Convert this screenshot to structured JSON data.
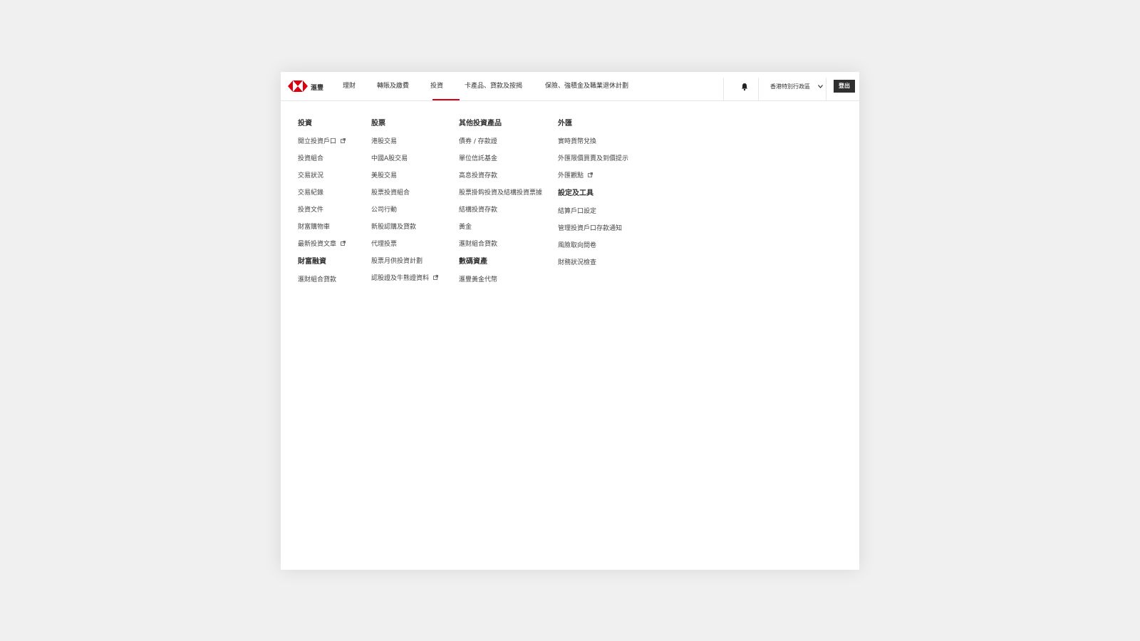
{
  "brand": {
    "name": "滙豐",
    "logo_icon": "hsbc-hexagon-logo-icon",
    "accent_color": "#db0011"
  },
  "nav": {
    "items": [
      {
        "label": "理財"
      },
      {
        "label": "轉賬及繳費"
      },
      {
        "label": "投資",
        "active": true
      },
      {
        "label": "卡產品、貸款及按揭"
      },
      {
        "label": "保險、強積金及職業退休計劃"
      }
    ],
    "notification_icon": "bell-icon",
    "region": "香港特別行政區",
    "logout_label": "登出"
  },
  "menu": {
    "columns": [
      {
        "groups": [
          {
            "title": "投資",
            "links": [
              {
                "label": "開立投資戶口",
                "external": true
              },
              {
                "label": "投資組合"
              },
              {
                "label": "交易狀況"
              },
              {
                "label": "交易紀錄"
              },
              {
                "label": "投資文件"
              },
              {
                "label": "財富購物車"
              },
              {
                "label": "最新投資文章",
                "external": true
              }
            ]
          },
          {
            "title": "財富融資",
            "links": [
              {
                "label": "滙財組合貸款"
              }
            ]
          }
        ]
      },
      {
        "groups": [
          {
            "title": "股票",
            "links": [
              {
                "label": "港股交易"
              },
              {
                "label": "中國A股交易"
              },
              {
                "label": "美股交易"
              },
              {
                "label": "股票投資組合"
              },
              {
                "label": "公司行動"
              },
              {
                "label": "新股認購及貸款"
              },
              {
                "label": "代理投票"
              },
              {
                "label": "股票月供投資計劃"
              },
              {
                "label": "認股證及牛熊證資料",
                "external": true
              }
            ]
          }
        ]
      },
      {
        "groups": [
          {
            "title": "其他投資產品",
            "links": [
              {
                "label": "債券 / 存款證"
              },
              {
                "label": "單位信託基金"
              },
              {
                "label": "高息投資存款"
              },
              {
                "label": "股票掛鈎投資及結構投資票據"
              },
              {
                "label": "結構投資存款"
              },
              {
                "label": "黃金"
              },
              {
                "label": "滙財組合貸款"
              }
            ]
          },
          {
            "title": "數碼資產",
            "links": [
              {
                "label": "滙豐黃金代幣"
              }
            ]
          }
        ]
      },
      {
        "groups": [
          {
            "title": "外匯",
            "links": [
              {
                "label": "實時貨幣兌換"
              },
              {
                "label": "外匯限價買賣及到價提示"
              },
              {
                "label": "外匯觀點",
                "external": true
              }
            ]
          },
          {
            "title": "設定及工具",
            "links": [
              {
                "label": "結算戶口設定"
              },
              {
                "label": "管理投資戶口存款通知"
              },
              {
                "label": "風險取向問卷"
              },
              {
                "label": "財務狀況檢查"
              }
            ]
          }
        ]
      }
    ]
  }
}
